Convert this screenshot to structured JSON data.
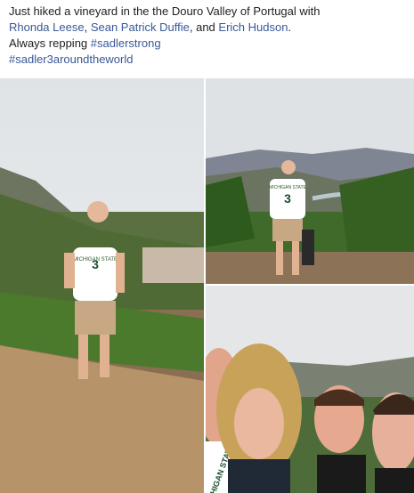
{
  "post": {
    "text_1": "Just hiked a vineyard in the the Douro  Valley of Portugal with",
    "tag_1": "Rhonda Leese",
    "sep_1": ",",
    "tag_2": "Sean Patrick Duffie",
    "sep_2": ", and",
    "tag_3": "Erich Hudson",
    "end": ".",
    "text_2": "Always repping",
    "hashtag_1": "#sadlerstrong",
    "hashtag_2": "#sadler3aroundtheworld"
  },
  "photos": {
    "shirt_text": "MICHIGAN STATE",
    "shirt_number": "3"
  }
}
